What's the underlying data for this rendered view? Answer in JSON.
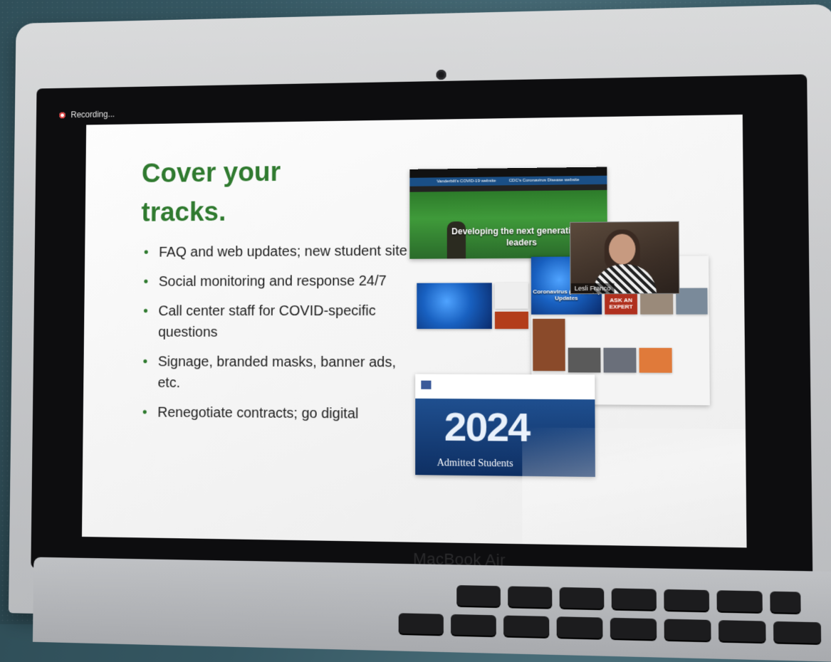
{
  "recording": {
    "label": "Recording..."
  },
  "slide": {
    "title": "Cover your tracks.",
    "bullets": [
      "FAQ and web updates; new student site",
      "Social monitoring and response 24/7",
      "Call center staff for COVID-specific questions",
      "Signage, branded masks, banner ads, etc.",
      "Renegotiate contracts; go digital"
    ]
  },
  "collage": {
    "web1": {
      "hero_caption": "Developing the next generation of leaders",
      "alert_left": "Vanderbilt's COVID-19 website",
      "alert_right": "CDC's Coronavirus Disease website"
    },
    "web2": {
      "covid_title": "Coronavirus (COVID-19) Updates",
      "ask_expert": "ASK AN EXPERT"
    },
    "web3": {
      "year": "2024",
      "admitted": "Admitted Students"
    }
  },
  "video": {
    "participant_name": "Lesli Franco"
  },
  "laptop": {
    "brand": "MacBook Air"
  },
  "colors": {
    "title_green": "#2f7a2f",
    "slide_bg": "#f3f3f3",
    "bezel": "#0d0d0f",
    "wall": "#355762"
  }
}
